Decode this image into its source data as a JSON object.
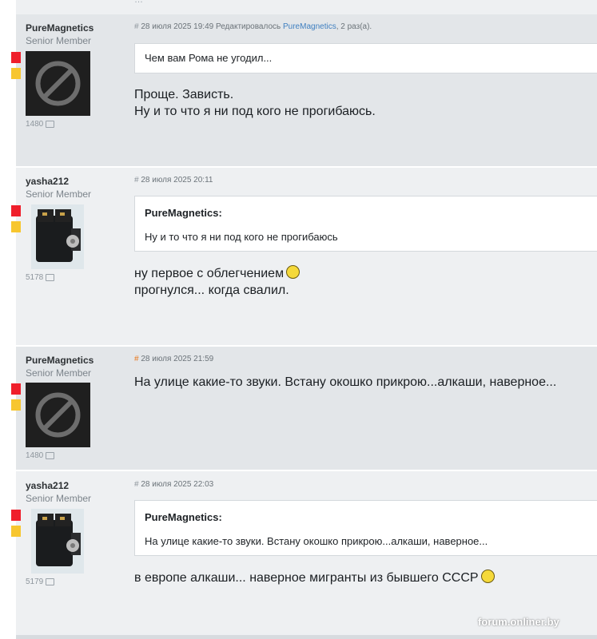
{
  "site": {
    "watermark": "forum.onliner.by"
  },
  "colors": {
    "mark_red": "#ef1f2b",
    "mark_yellow": "#f7c62f",
    "link": "#3f7fc0",
    "hash_new": "#e8771b"
  },
  "posts": [
    {
      "author": "PureMagnetics",
      "rank": "Senior Member",
      "count": "1480",
      "hash": "#",
      "date": "28 июля 2025 19:49",
      "edit_prefix": "Редактировалось",
      "edit_user": "PureMagnetics",
      "edit_suffix": ", 2 раз(а).",
      "quote_text": "Чем вам Рома не угодил...",
      "lines": [
        "Проще. Зависть.",
        "Ну и то что я ни под кого не прогибаюсь."
      ]
    },
    {
      "author": "yasha212",
      "rank": "Senior Member",
      "count": "5178",
      "hash": "#",
      "date": "28 июля 2025 20:11",
      "quote_author": "PureMagnetics:",
      "quote_text": "Ну и то что я ни под кого не прогибаюсь",
      "lines": [
        "ну первое с облегчением",
        "прогнулся... когда свалил."
      ]
    },
    {
      "author": "PureMagnetics",
      "rank": "Senior Member",
      "count": "1480",
      "hash": "#",
      "date": "28 июля 2025 21:59",
      "lines": [
        "На улице какие-то звуки. Встану окошко прикрою...алкаши, наверное..."
      ]
    },
    {
      "author": "yasha212",
      "rank": "Senior Member",
      "count": "5179",
      "hash": "#",
      "date": "28 июля 2025 22:03",
      "quote_author": "PureMagnetics:",
      "quote_text": "На улице какие-то звуки. Встану окошко прикрою...алкаши, наверное...",
      "lines": [
        "в европе алкаши... наверное мигранты из бывшего СССР"
      ]
    }
  ],
  "icons": {
    "avatar_blocked": "blocked-avatar-icon",
    "reply_count": "speech-bubble-icon",
    "smile": "laughing-emoji-icon"
  }
}
